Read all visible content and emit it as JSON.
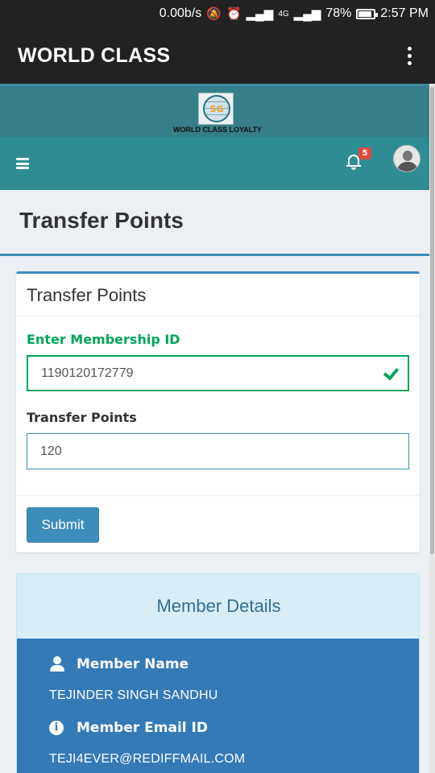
{
  "status_bar": {
    "net_speed": "0.00b/s",
    "battery_percent": "78%",
    "time": "2:57 PM",
    "network": "4G"
  },
  "app_bar": {
    "title": "WORLD CLASS"
  },
  "header": {
    "logo_monogram": "SG",
    "logo_caption": "WORLD CLASS LOYALTY",
    "notification_count": "5"
  },
  "page": {
    "title": "Transfer Points"
  },
  "form": {
    "box_title": "Transfer Points",
    "membership_label": "Enter Membership ID",
    "membership_value": "1190120172779",
    "points_label": "Transfer Points",
    "points_value": "120",
    "submit_label": "Submit"
  },
  "member_details": {
    "heading": "Member Details",
    "name_label": "Member Name",
    "name_value": "TEJINDER SINGH SANDHU",
    "email_label": "Member Email ID",
    "email_value": "TEJI4EVER@REDIFFMAIL.COM"
  },
  "colors": {
    "primary": "#3c8dbc",
    "success": "#00a65a",
    "header_teal": "#2f8c95",
    "details_blue": "#337ab7"
  }
}
